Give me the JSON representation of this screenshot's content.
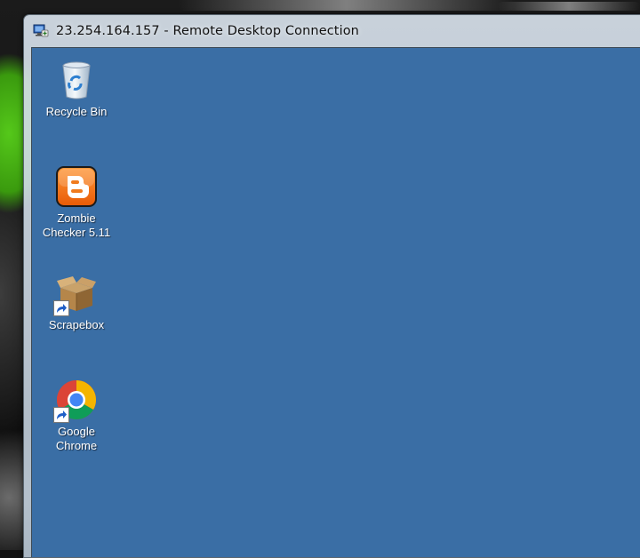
{
  "window": {
    "title": "23.254.164.157 - Remote Desktop Connection",
    "title_icon": "remote-desktop-icon"
  },
  "desktop": {
    "background_color": "#3a6ea5",
    "icons": [
      {
        "name": "recycle-bin",
        "label": "Recycle Bin",
        "icon": "recycle-bin-icon",
        "shortcut": false
      },
      {
        "name": "zombie-checker",
        "label": "Zombie\nChecker 5.11",
        "icon": "blogger-icon",
        "shortcut": false
      },
      {
        "name": "scrapebox",
        "label": "Scrapebox",
        "icon": "box-icon",
        "shortcut": true
      },
      {
        "name": "google-chrome",
        "label": "Google\nChrome",
        "icon": "chrome-icon",
        "shortcut": true
      }
    ]
  }
}
